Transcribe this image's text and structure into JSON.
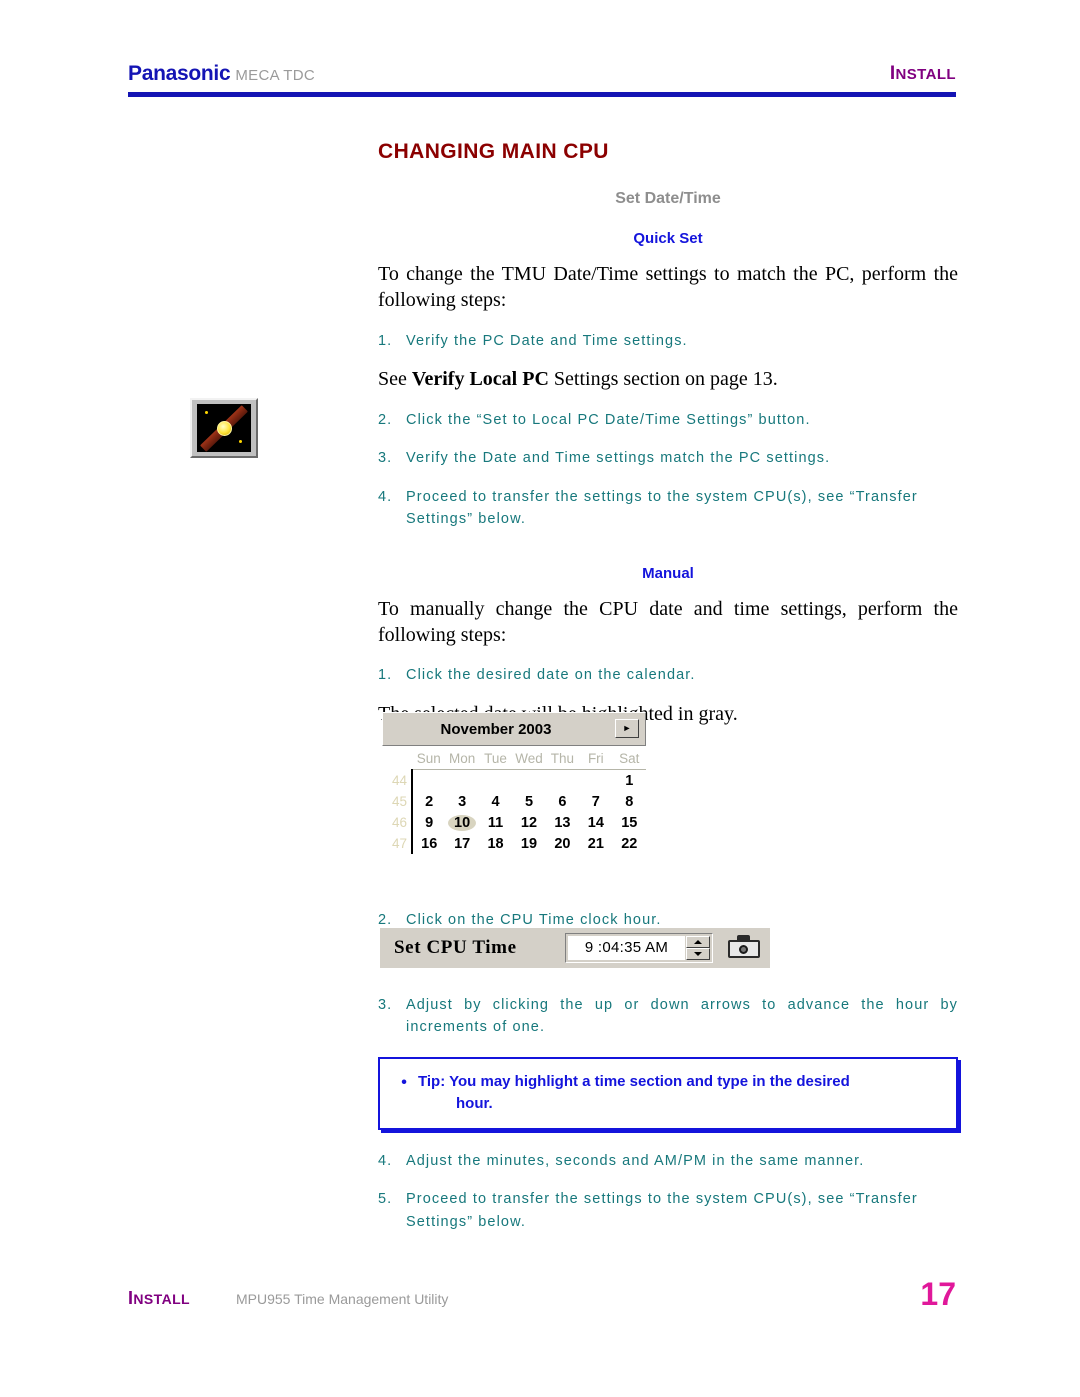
{
  "header": {
    "brand": "Panasonic",
    "product": "MECA TDC",
    "section_cap": "I",
    "section_rest": "NSTALL"
  },
  "main": {
    "title": "CHANGING MAIN CPU",
    "subtitle": "Set Date/Time",
    "quick_set_heading": "Quick Set",
    "quick_set_intro": "To change the TMU Date/Time settings to match the PC, perform the following steps:",
    "quick_set_steps": [
      {
        "num": "1.",
        "text": "Verify the PC Date and Time settings."
      },
      {
        "num": "2.",
        "text": "Click the “Set to Local PC Date/Time Settings” button."
      },
      {
        "num": "3.",
        "text": "Verify the Date and Time settings match the PC settings."
      },
      {
        "num": "4.",
        "text": "Proceed to transfer the settings to the system CPU(s), see “Transfer Settings” below."
      }
    ],
    "see_reference_pre": "See ",
    "see_reference_bold": "Verify Local PC",
    "see_reference_post": " Settings section on page 13.",
    "manual_heading": "Manual",
    "manual_intro": "To manually change the CPU date and time settings, perform the following steps:",
    "manual_step_1": {
      "num": "1.",
      "text": "Click the desired date on the calendar."
    },
    "highlight_note": "The selected date will be highlighted in gray.",
    "manual_step_2": {
      "num": "2.",
      "text": "Click on the CPU Time clock hour."
    },
    "manual_step_3": {
      "num": "3.",
      "text": "Adjust by clicking the up or down arrows to advance the hour by increments of one."
    },
    "manual_step_4": {
      "num": "4.",
      "text": "Adjust the minutes, seconds and AM/PM in the same manner."
    },
    "manual_step_5": {
      "num": "5.",
      "text": "Proceed to transfer the settings to the system CPU(s), see “Transfer Settings” below."
    }
  },
  "tip": {
    "bullet": "•",
    "line1": "Tip:  You may highlight a time section and type in the desired",
    "line2": "hour."
  },
  "calendar": {
    "month_year": "November 2003",
    "next_arrow": "►",
    "day_headers": [
      "Sun",
      "Mon",
      "Tue",
      "Wed",
      "Thu",
      "Fri",
      "Sat"
    ],
    "week_numbers": [
      "44",
      "45",
      "46",
      "47"
    ],
    "weeks": [
      [
        "",
        "",
        "",
        "",
        "",
        "",
        "1"
      ],
      [
        "2",
        "3",
        "4",
        "5",
        "6",
        "7",
        "8"
      ],
      [
        "9",
        "10",
        "11",
        "12",
        "13",
        "14",
        "15"
      ],
      [
        "16",
        "17",
        "18",
        "19",
        "20",
        "21",
        "22"
      ]
    ],
    "selected_day": "10"
  },
  "cpu_time": {
    "label": "Set CPU Time",
    "value": "9 :04:35 AM",
    "up_arrow_name": "increment",
    "down_arrow_name": "decrement",
    "camera_button_name": "snapshot"
  },
  "footer": {
    "section_cap": "I",
    "section_rest": "NSTALL",
    "document_title": "MPU955 Time Management Utility",
    "page_number": "17"
  },
  "colors": {
    "brand_blue": "#1414b4",
    "title_red": "#8b0000",
    "step_teal": "#17787c",
    "accent_blue": "#1414dc",
    "purple": "#800080",
    "magenta": "#e0189a",
    "gray": "#9a9a9a"
  }
}
